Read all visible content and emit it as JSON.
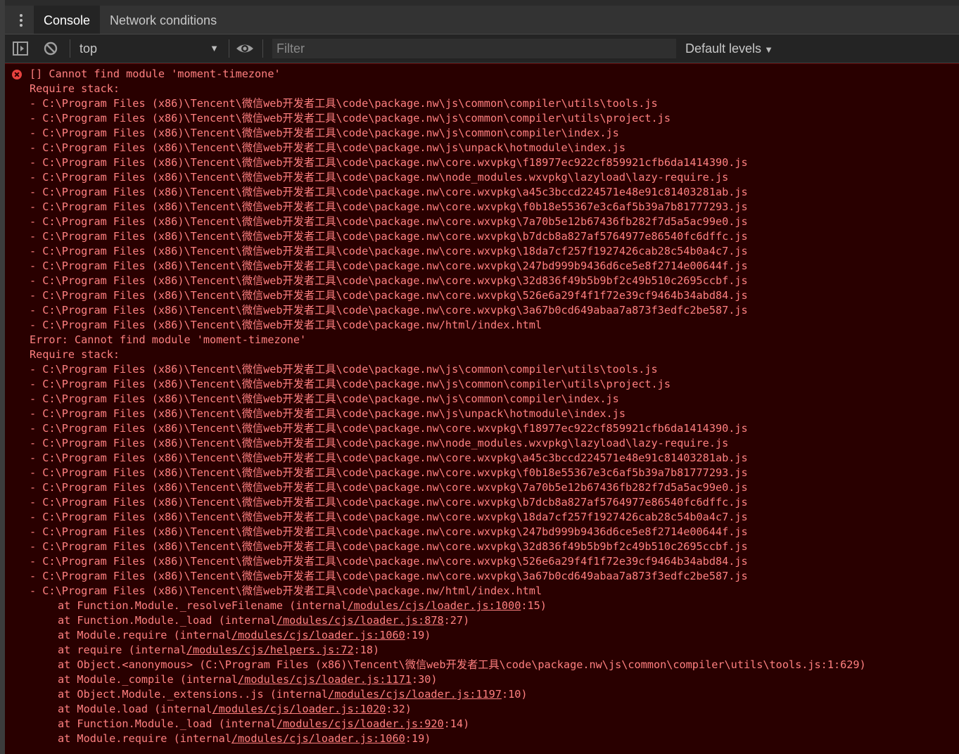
{
  "tabs": [
    {
      "label": "Console",
      "active": true
    },
    {
      "label": "Network conditions",
      "active": false
    }
  ],
  "toolbar": {
    "context_value": "top",
    "filter_placeholder": "Filter",
    "levels_label": "Default levels",
    "caret": "▼"
  },
  "colors": {
    "error_bg": "#290000",
    "error_text": "#ff8080",
    "error_icon": "#e8423f"
  },
  "console": {
    "stack_paths": [
      "C:\\Program Files (x86)\\Tencent\\微信web开发者工具\\code\\package.nw\\js\\common\\compiler\\utils\\tools.js",
      "C:\\Program Files (x86)\\Tencent\\微信web开发者工具\\code\\package.nw\\js\\common\\compiler\\utils\\project.js",
      "C:\\Program Files (x86)\\Tencent\\微信web开发者工具\\code\\package.nw\\js\\common\\compiler\\index.js",
      "C:\\Program Files (x86)\\Tencent\\微信web开发者工具\\code\\package.nw\\js\\unpack\\hotmodule\\index.js",
      "C:\\Program Files (x86)\\Tencent\\微信web开发者工具\\code\\package.nw\\core.wxvpkg\\f18977ec922cf859921cfb6da1414390.js",
      "C:\\Program Files (x86)\\Tencent\\微信web开发者工具\\code\\package.nw\\node_modules.wxvpkg\\lazyload\\lazy-require.js",
      "C:\\Program Files (x86)\\Tencent\\微信web开发者工具\\code\\package.nw\\core.wxvpkg\\a45c3bccd224571e48e91c81403281ab.js",
      "C:\\Program Files (x86)\\Tencent\\微信web开发者工具\\code\\package.nw\\core.wxvpkg\\f0b18e55367e3c6af5b39a7b81777293.js",
      "C:\\Program Files (x86)\\Tencent\\微信web开发者工具\\code\\package.nw\\core.wxvpkg\\7a70b5e12b67436fb282f7d5a5ac99e0.js",
      "C:\\Program Files (x86)\\Tencent\\微信web开发者工具\\code\\package.nw\\core.wxvpkg\\b7dcb8a827af5764977e86540fc6dffc.js",
      "C:\\Program Files (x86)\\Tencent\\微信web开发者工具\\code\\package.nw\\core.wxvpkg\\18da7cf257f1927426cab28c54b0a4c7.js",
      "C:\\Program Files (x86)\\Tencent\\微信web开发者工具\\code\\package.nw\\core.wxvpkg\\247bd999b9436d6ce5e8f2714e00644f.js",
      "C:\\Program Files (x86)\\Tencent\\微信web开发者工具\\code\\package.nw\\core.wxvpkg\\32d836f49b5b9bf2c49b510c2695ccbf.js",
      "C:\\Program Files (x86)\\Tencent\\微信web开发者工具\\code\\package.nw\\core.wxvpkg\\526e6a29f4f1f72e39cf9464b34abd84.js",
      "C:\\Program Files (x86)\\Tencent\\微信web开发者工具\\code\\package.nw\\core.wxvpkg\\3a67b0cd649abaa7a873f3edfc2be587.js",
      "C:\\Program Files (x86)\\Tencent\\微信web开发者工具\\code\\package.nw/html/index.html"
    ],
    "lines": [
      {
        "kind": "text",
        "text": "[] Cannot find module 'moment-timezone'"
      },
      {
        "kind": "text",
        "text": "Require stack:"
      },
      {
        "kind": "stack"
      },
      {
        "kind": "text",
        "text": "Error: Cannot find module 'moment-timezone'"
      },
      {
        "kind": "text",
        "text": "Require stack:"
      },
      {
        "kind": "stack"
      },
      {
        "kind": "at",
        "pre": "at Function.Module._resolveFilename (internal",
        "link": "/modules/cjs/loader.js:1000",
        "post": ":15)"
      },
      {
        "kind": "at",
        "pre": "at Function.Module._load (internal",
        "link": "/modules/cjs/loader.js:878",
        "post": ":27)"
      },
      {
        "kind": "at",
        "pre": "at Module.require (internal",
        "link": "/modules/cjs/loader.js:1060",
        "post": ":19)"
      },
      {
        "kind": "at",
        "pre": "at require (internal",
        "link": "/modules/cjs/helpers.js:72",
        "post": ":18)"
      },
      {
        "kind": "at",
        "pre": "at Object.<anonymous> (C:\\Program Files (x86)\\Tencent\\微信web开发者工具\\code\\package.nw\\js\\common\\compiler\\utils\\tools.js:1:629)",
        "link": "",
        "post": ""
      },
      {
        "kind": "at",
        "pre": "at Module._compile (internal",
        "link": "/modules/cjs/loader.js:1171",
        "post": ":30)"
      },
      {
        "kind": "at",
        "pre": "at Object.Module._extensions..js (internal",
        "link": "/modules/cjs/loader.js:1197",
        "post": ":10)"
      },
      {
        "kind": "at",
        "pre": "at Module.load (internal",
        "link": "/modules/cjs/loader.js:1020",
        "post": ":32)"
      },
      {
        "kind": "at",
        "pre": "at Function.Module._load (internal",
        "link": "/modules/cjs/loader.js:920",
        "post": ":14)"
      },
      {
        "kind": "at",
        "pre": "at Module.require (internal",
        "link": "/modules/cjs/loader.js:1060",
        "post": ":19)"
      }
    ]
  }
}
